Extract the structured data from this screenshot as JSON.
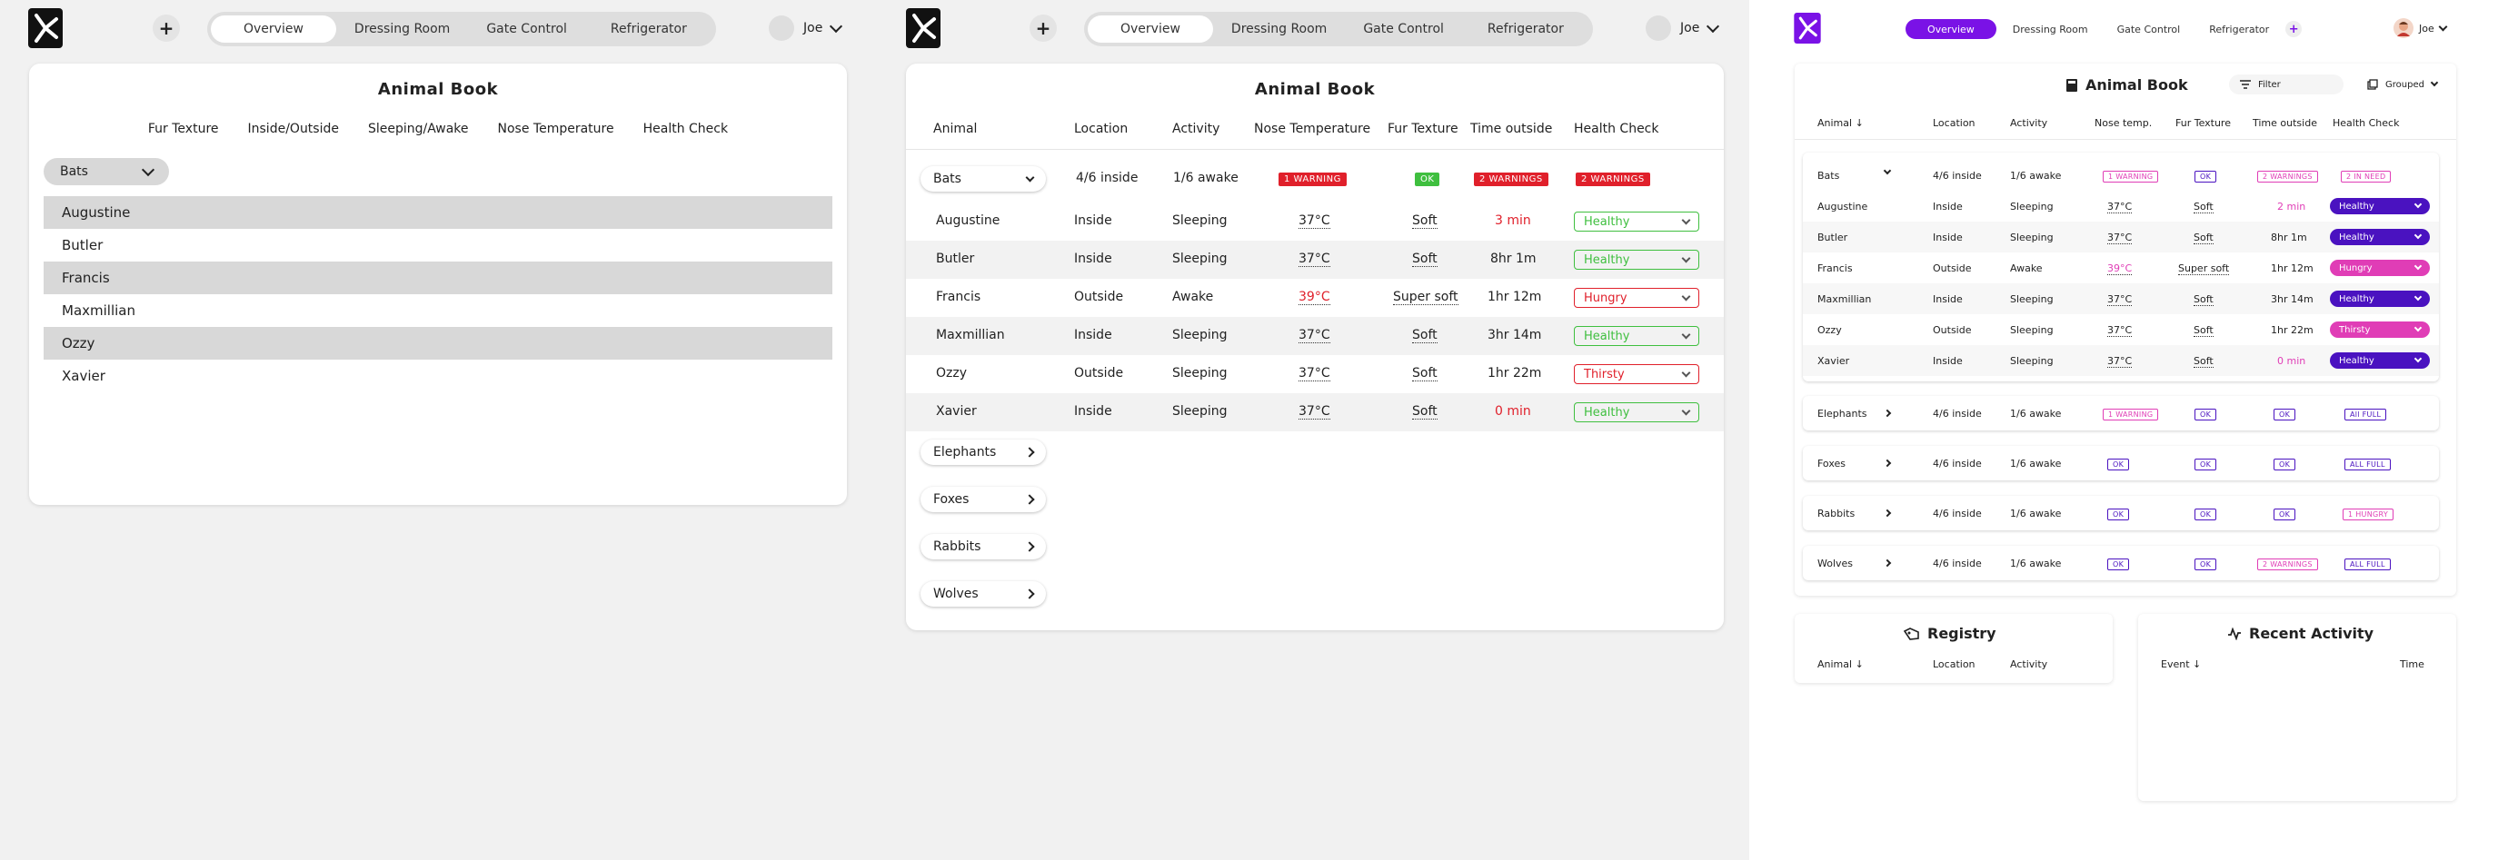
{
  "nav": {
    "tabs": [
      "Overview",
      "Dressing Room",
      "Gate Control",
      "Refrigerator"
    ],
    "active_tab": "Overview",
    "user_name": "Joe"
  },
  "colors": {
    "accent_purple": "#7a12e6",
    "alert_red": "#e0202b",
    "ok_green": "#3fbf3f",
    "alert_pink": "#e03db6"
  },
  "book_title": "Animal Book",
  "panel1": {
    "filters": [
      "Fur Texture",
      "Inside/Outside",
      "Sleeping/Awake",
      "Nose Temperature",
      "Health Check"
    ],
    "selected_group": "Bats",
    "animals": [
      "Augustine",
      "Butler",
      "Francis",
      "Maxmillian",
      "Ozzy",
      "Xavier"
    ]
  },
  "panel2": {
    "columns": [
      "Animal",
      "Location",
      "Activity",
      "Nose Temperature",
      "Fur Texture",
      "Time outside",
      "Health Check"
    ],
    "group": {
      "name": "Bats",
      "location": "4/6 inside",
      "activity": "1/6 awake",
      "nose": "1 WARNING",
      "fur": "OK",
      "time": "2 WARNINGS",
      "health": "2 WARNINGS"
    },
    "rows": [
      {
        "animal": "Augustine",
        "location": "Inside",
        "activity": "Sleeping",
        "nose": "37°C",
        "fur": "Soft",
        "time": "3 min",
        "health": "Healthy"
      },
      {
        "animal": "Butler",
        "location": "Inside",
        "activity": "Sleeping",
        "nose": "37°C",
        "fur": "Soft",
        "time": "8hr 1m",
        "health": "Healthy"
      },
      {
        "animal": "Francis",
        "location": "Outside",
        "activity": "Awake",
        "nose": "39°C",
        "fur": "Super soft",
        "time": "1hr 12m",
        "health": "Hungry"
      },
      {
        "animal": "Maxmillian",
        "location": "Inside",
        "activity": "Sleeping",
        "nose": "37°C",
        "fur": "Soft",
        "time": "3hr 14m",
        "health": "Healthy"
      },
      {
        "animal": "Ozzy",
        "location": "Outside",
        "activity": "Sleeping",
        "nose": "37°C",
        "fur": "Soft",
        "time": "1hr 22m",
        "health": "Thirsty"
      },
      {
        "animal": "Xavier",
        "location": "Inside",
        "activity": "Sleeping",
        "nose": "37°C",
        "fur": "Soft",
        "time": "0 min",
        "health": "Healthy"
      }
    ],
    "other_groups": [
      "Elephants",
      "Foxes",
      "Rabbits",
      "Wolves"
    ]
  },
  "panel3": {
    "filter_label": "Filter",
    "grouped_label": "Grouped",
    "columns": [
      "Animal",
      "Location",
      "Activity",
      "Nose temp.",
      "Fur Texture",
      "Time outside",
      "Health Check"
    ],
    "sort_arrow": "↓",
    "group": {
      "name": "Bats",
      "location": "4/6 inside",
      "activity": "1/6 awake",
      "nose": "1 WARNING",
      "fur": "OK",
      "time": "2 WARNINGS",
      "health": "2 IN NEED"
    },
    "rows": [
      {
        "animal": "Augustine",
        "location": "Inside",
        "activity": "Sleeping",
        "nose": "37°C",
        "fur": "Soft",
        "time": "2 min",
        "health": "Healthy"
      },
      {
        "animal": "Butler",
        "location": "Inside",
        "activity": "Sleeping",
        "nose": "37°C",
        "fur": "Soft",
        "time": "8hr 1m",
        "health": "Healthy"
      },
      {
        "animal": "Francis",
        "location": "Outside",
        "activity": "Awake",
        "nose": "39°C",
        "fur": "Super soft",
        "time": "1hr 12m",
        "health": "Hungry"
      },
      {
        "animal": "Maxmillian",
        "location": "Inside",
        "activity": "Sleeping",
        "nose": "37°C",
        "fur": "Soft",
        "time": "3hr 14m",
        "health": "Healthy"
      },
      {
        "animal": "Ozzy",
        "location": "Outside",
        "activity": "Sleeping",
        "nose": "37°C",
        "fur": "Soft",
        "time": "1hr 22m",
        "health": "Thirsty"
      },
      {
        "animal": "Xavier",
        "location": "Inside",
        "activity": "Sleeping",
        "nose": "37°C",
        "fur": "Soft",
        "time": "0 min",
        "health": "Healthy"
      }
    ],
    "groups": [
      {
        "name": "Elephants",
        "location": "4/6 inside",
        "activity": "1/6 awake",
        "nose": "1 WARNING",
        "fur": "OK",
        "time": "OK",
        "health": "All FULL"
      },
      {
        "name": "Foxes",
        "location": "4/6 inside",
        "activity": "1/6 awake",
        "nose": "OK",
        "fur": "OK",
        "time": "OK",
        "health": "ALL FULL"
      },
      {
        "name": "Rabbits",
        "location": "4/6 inside",
        "activity": "1/6 awake",
        "nose": "OK",
        "fur": "OK",
        "time": "OK",
        "health": "1 HUNGRY"
      },
      {
        "name": "Wolves",
        "location": "4/6 inside",
        "activity": "1/6 awake",
        "nose": "OK",
        "fur": "OK",
        "time": "2 WARNINGS",
        "health": "ALL FULL"
      }
    ],
    "registry": {
      "title": "Registry",
      "columns": [
        "Animal",
        "Location",
        "Activity"
      ]
    },
    "recent_activity": {
      "title": "Recent Activity",
      "columns": [
        "Event",
        "Time"
      ]
    }
  }
}
